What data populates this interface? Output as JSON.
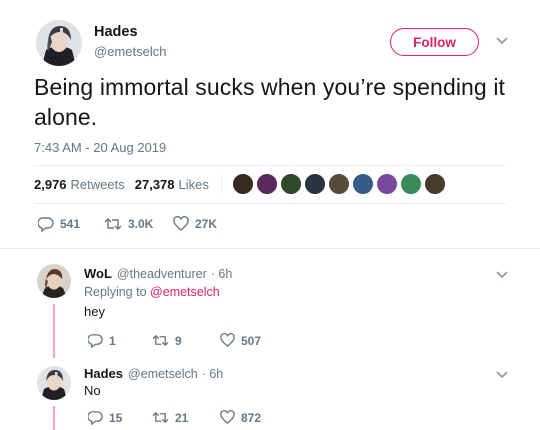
{
  "main_tweet": {
    "author_name": "Hades",
    "author_handle": "@emetselch",
    "follow_label": "Follow",
    "text": "Being immortal sucks when you’re spending it alone.",
    "timestamp": "7:43 AM - 20 Aug 2019",
    "retweets_count": "2,976",
    "retweets_label": "Retweets",
    "likes_count": "27,378",
    "likes_label": "Likes",
    "actions": {
      "replies": "541",
      "retweets": "3.0K",
      "likes": "27K"
    }
  },
  "liker_colors": [
    "#3a2a1e",
    "#5a2a5e",
    "#2e4a2a",
    "#2a3340",
    "#5a4a3a",
    "#3a5a8a",
    "#7a4a9a",
    "#3a8a5a",
    "#4a3a2a"
  ],
  "replies": [
    {
      "name": "WoL",
      "handle": "@theadventurer",
      "time": "· 6h",
      "replying_prefix": "Replying to",
      "replying_to": "@emetselch",
      "text": "hey",
      "actions": {
        "replies": "1",
        "retweets": "9",
        "likes": "507"
      }
    },
    {
      "name": "Hades",
      "handle": "@emetselch",
      "time": "· 6h",
      "text": "No",
      "actions": {
        "replies": "15",
        "retweets": "21",
        "likes": "872"
      }
    }
  ],
  "colors": {
    "accent": "#e0245e",
    "muted": "#657786",
    "text": "#14171a",
    "thread_line": "#f0a6bd"
  }
}
